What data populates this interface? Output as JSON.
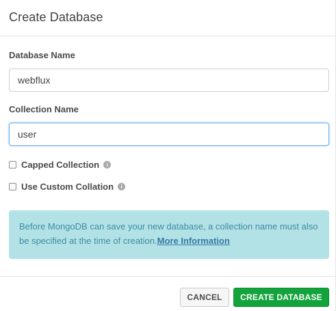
{
  "dialog": {
    "title": "Create Database"
  },
  "fields": {
    "database_name": {
      "label": "Database Name",
      "value": "webflux"
    },
    "collection_name": {
      "label": "Collection Name",
      "value": "user"
    }
  },
  "options": {
    "capped_collection": {
      "label": "Capped Collection",
      "checked": false,
      "info_icon": "info-icon"
    },
    "custom_collation": {
      "label": "Use Custom Collation",
      "checked": false,
      "info_icon": "info-icon"
    }
  },
  "info": {
    "text": "Before MongoDB can save your new database, a collection name must also be specified at the time of creation.",
    "link_text": "More Information"
  },
  "buttons": {
    "cancel": "CANCEL",
    "create": "CREATE DATABASE"
  },
  "colors": {
    "primary": "#13a33d",
    "info_background": "#b2e2e6",
    "info_text": "#3e8ba1",
    "focus_border": "#66afe9"
  }
}
